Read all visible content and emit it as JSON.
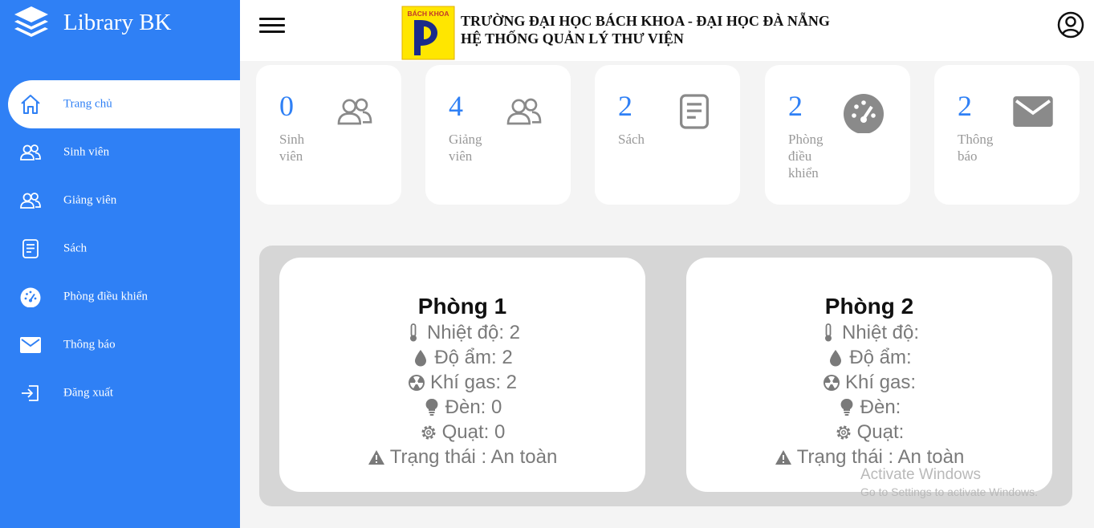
{
  "sidebar": {
    "brand": "Library BK",
    "items": [
      {
        "label": "Trang chủ",
        "icon": "home-icon",
        "active": true
      },
      {
        "label": "Sinh viên",
        "icon": "users-icon"
      },
      {
        "label": "Giảng viên",
        "icon": "users-icon"
      },
      {
        "label": "Sách",
        "icon": "document-icon"
      },
      {
        "label": "Phòng điều khiển",
        "icon": "dashboard-gauge-icon"
      },
      {
        "label": "Thông báo",
        "icon": "envelope-icon"
      },
      {
        "label": "Đăng xuất",
        "icon": "logout-icon"
      }
    ]
  },
  "header": {
    "logo_text": "BÁCH KHOA",
    "title_line1": "TRƯỜNG ĐẠI HỌC BÁCH KHOA - ĐẠI HỌC ĐÀ NẴNG",
    "title_line2": "HỆ THỐNG QUẢN LÝ THƯ VIỆN"
  },
  "stats": [
    {
      "count": "0",
      "label": "Sinh viên",
      "icon": "users-icon"
    },
    {
      "count": "4",
      "label": "Giảng viên",
      "icon": "users-icon"
    },
    {
      "count": "2",
      "label": "Sách",
      "icon": "document-icon"
    },
    {
      "count": "2",
      "label": "Phòng điều khiển",
      "icon": "dashboard-gauge-icon"
    },
    {
      "count": "2",
      "label": "Thông báo",
      "icon": "envelope-icon"
    }
  ],
  "rooms": [
    {
      "title": "Phòng 1",
      "temperature": "Nhiệt độ: 2",
      "humidity": "Độ ẩm: 2",
      "gas": "Khí gas: 2",
      "light": "Đèn: 0",
      "fan": "Quạt: 0",
      "status": "Trạng thái : An toàn"
    },
    {
      "title": "Phòng 2",
      "temperature": "Nhiệt độ:",
      "humidity": "Độ ẩm:",
      "gas": "Khí gas:",
      "light": "Đèn:",
      "fan": "Quạt:",
      "status": "Trạng thái : An toàn"
    }
  ],
  "watermark": {
    "line1": "Activate Windows",
    "line2": "Go to Settings to activate Windows."
  },
  "colors": {
    "accent": "#2f80f5",
    "card_bg": "#ffffff",
    "panel_bg": "#d6d6d6",
    "muted_text": "#999999"
  }
}
